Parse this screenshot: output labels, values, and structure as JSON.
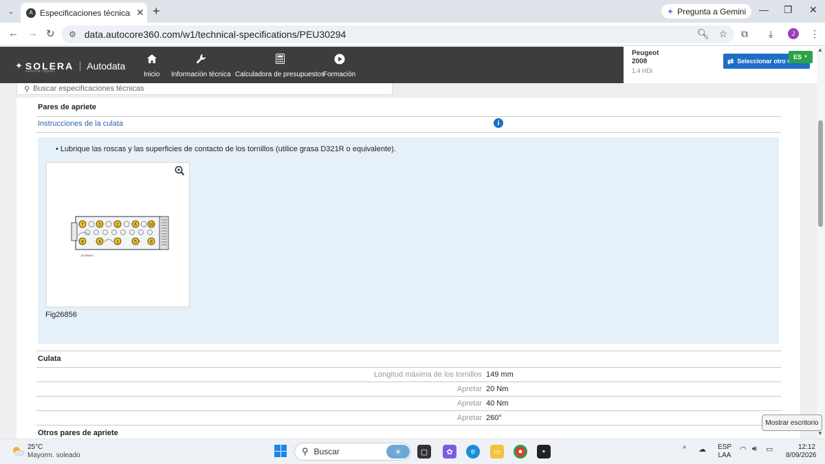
{
  "browser": {
    "tab_title": "Especificaciones técnicas | Auto",
    "url": "data.autocore360.com/w1/technical-specifications/PEU30294",
    "gemini_label": "Pregunta a Gemini",
    "profile_initial": "J"
  },
  "header": {
    "brand": "SOLERA",
    "brand_sub": "vehicle repair",
    "product": "Autodata",
    "nav": [
      {
        "label": "Inicio",
        "icon": "home-icon"
      },
      {
        "label": "Información técnica",
        "icon": "wrench-icon"
      },
      {
        "label": "Calculadora de presupuestos",
        "icon": "calculator-icon"
      },
      {
        "label": "Formación",
        "icon": "play-icon"
      }
    ],
    "vehicle": {
      "make": "Peugeot",
      "model": "2008",
      "engine": "1.4 HDi"
    },
    "select_vehicle_label": "Seleccionar otro v",
    "language": "ES"
  },
  "search": {
    "placeholder": "Buscar especificaciones técnicas"
  },
  "content": {
    "section1_title": "Pares de apriete",
    "instructions_link": "Instrucciones de la culata",
    "bullet": "Lubrique las roscas y las superficies de contacto de los tornillos (utilice grasa D321R o equivalente).",
    "figure_caption": "Fig26856",
    "figure_code": "62265464",
    "bolt_top": [
      "7",
      "3",
      "2",
      "6",
      "10"
    ],
    "bolt_bottom": [
      "8",
      "4",
      "1",
      "5",
      "9"
    ],
    "section2_title": "Culata",
    "specs": [
      {
        "label": "Longitud máxima de los tornillos",
        "value": "149 mm"
      },
      {
        "label": "Apretar",
        "value": "20 Nm"
      },
      {
        "label": "Apretar",
        "value": "40 Nm"
      },
      {
        "label": "Apretar",
        "value": "260°"
      }
    ],
    "section3_title": "Otros pares de apriete"
  },
  "tooltip": "Mostrar escritorio",
  "taskbar": {
    "temp": "25°C",
    "weather": "Mayorm. soleado",
    "search_placeholder": "Buscar",
    "lang_top": "ESP",
    "lang_bottom": "LAA",
    "time": "12:12",
    "date": "8/09/2026"
  },
  "colors": {
    "header_bg": "#3d3d3d",
    "accent_blue": "#1d6ec4",
    "lang_green": "#2aa248",
    "instr_bg": "#e5f0f8",
    "bolt_yellow": "#f2c21b"
  }
}
